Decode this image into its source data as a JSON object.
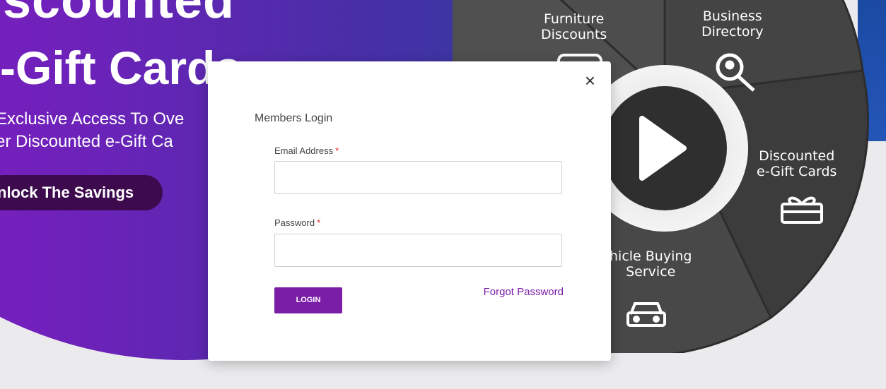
{
  "hero": {
    "title_line1": "scounted",
    "title_line2": "-Gift Cards",
    "subtitle_line1": "Exclusive Access To Ove",
    "subtitle_line2": "er Discounted e-Gift Ca",
    "cta_label": "nlock The Savings"
  },
  "wheel": {
    "segments": {
      "furniture": "Furniture\nDiscounts",
      "business": "Business\nDirectory",
      "giftcards": "Discounted\ne-Gift Cards",
      "vehicle": "hicle Buying\nService"
    },
    "icons": [
      "sofa-icon",
      "magnifier-pin-icon",
      "gift-box-icon",
      "car-icon",
      "play-icon"
    ]
  },
  "modal": {
    "title": "Members Login",
    "email_label": "Email Address",
    "password_label": "Password",
    "required_mark": "*",
    "login_label": "LOGIN",
    "forgot_label": "Forgot Password",
    "close_glyph": "×"
  },
  "colors": {
    "brand_purple": "#7a1ea8",
    "hero_gradient_start": "#8a18c7",
    "hero_gradient_end": "#2f3b9f",
    "wheel_dark": "#3a3a3a",
    "required": "#e02020"
  }
}
